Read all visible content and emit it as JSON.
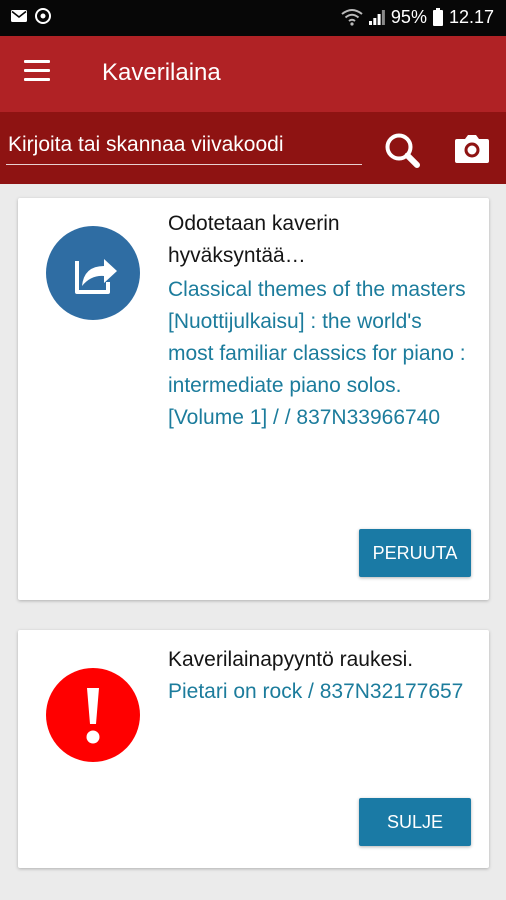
{
  "status_bar": {
    "battery": "95%",
    "time": "12.17",
    "icons": [
      "mail-icon",
      "sync-icon",
      "wifi-icon",
      "signal-icon",
      "battery-icon"
    ]
  },
  "app_bar": {
    "title": "Kaverilaina",
    "menu_icon": "menu-icon"
  },
  "search": {
    "placeholder": "Kirjoita tai skannaa viivakoodi",
    "value": "",
    "search_icon": "search-icon",
    "camera_icon": "camera-icon"
  },
  "cards": [
    {
      "icon": "share-icon",
      "icon_color": "#2f6da3",
      "status": "Odotetaan kaverin hyväksyntää…",
      "link": "Classical themes of the masters [Nuottijulkaisu] : the world's most familiar classics for piano : intermediate piano solos. [Volume 1] / / 837N33966740",
      "button": "PERUUTA"
    },
    {
      "icon": "exclamation-icon",
      "icon_color": "#ff0000",
      "status": "Kaverilainapyyntö raukesi.",
      "link": "Pietari on rock / 837N32177657",
      "button": "SULJE"
    }
  ],
  "colors": {
    "app_bar": "#b02225",
    "search_bar": "#8e1312",
    "link": "#1c7c9c",
    "button": "#1a7aa5"
  }
}
